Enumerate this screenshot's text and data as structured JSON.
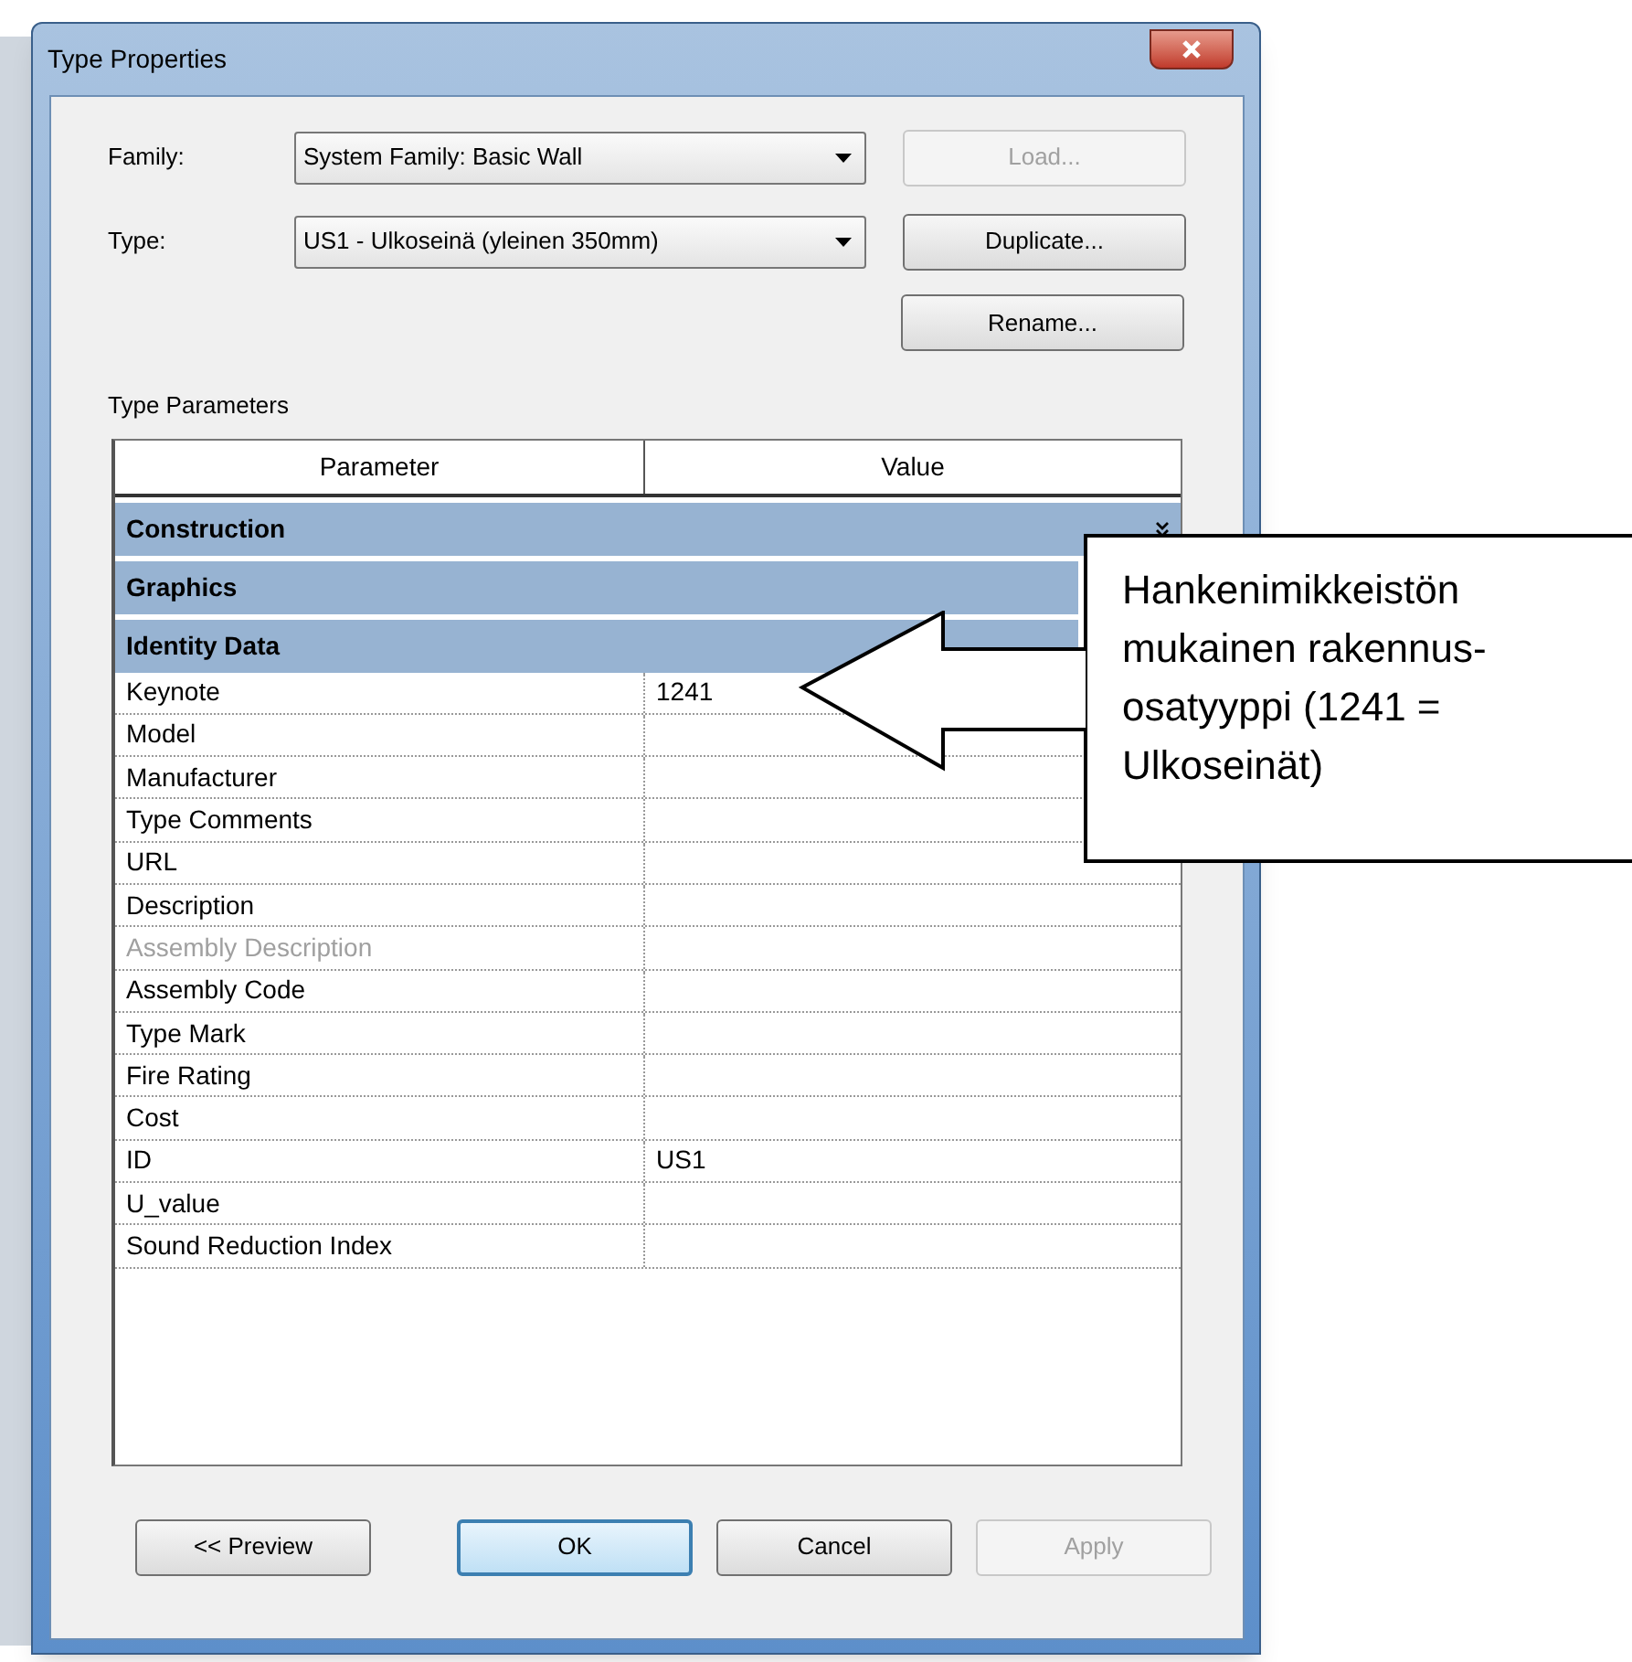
{
  "window": {
    "title": "Type Properties"
  },
  "fields": [
    {
      "label": "Family:",
      "value": "System Family: Basic Wall",
      "button": {
        "label": "Load...",
        "disabled": true
      }
    },
    {
      "label": "Type:",
      "value": "US1 - Ulkoseinä (yleinen 350mm)",
      "button": {
        "label": "Duplicate...",
        "disabled": false
      }
    }
  ],
  "rename_button": {
    "label": "Rename...",
    "disabled": false
  },
  "section_title": "Type Parameters",
  "table": {
    "columns": [
      "Parameter",
      "Value"
    ],
    "rows": [
      {
        "kind": "category",
        "label": "Construction",
        "expanded": false
      },
      {
        "kind": "category",
        "label": "Graphics"
      },
      {
        "kind": "category",
        "label": "Identity Data"
      },
      {
        "kind": "param",
        "label": "Keynote",
        "value": "1241",
        "disabled": false
      },
      {
        "kind": "param",
        "label": "Model",
        "disabled": false
      },
      {
        "kind": "param",
        "label": "Manufacturer",
        "disabled": false
      },
      {
        "kind": "param",
        "label": "Type Comments",
        "disabled": false
      },
      {
        "kind": "param",
        "label": "URL",
        "disabled": false
      },
      {
        "kind": "param",
        "label": "Description",
        "disabled": false
      },
      {
        "kind": "param",
        "label": "Assembly Description",
        "disabled": true
      },
      {
        "kind": "param",
        "label": "Assembly Code",
        "disabled": false
      },
      {
        "kind": "param",
        "label": "Type Mark",
        "disabled": false
      },
      {
        "kind": "param",
        "label": "Fire Rating",
        "disabled": false
      },
      {
        "kind": "param",
        "label": "Cost",
        "disabled": false
      },
      {
        "kind": "param",
        "label": "ID",
        "value": "US1",
        "disabled": false
      },
      {
        "kind": "param",
        "label": "U_value",
        "disabled": false
      },
      {
        "kind": "param",
        "label": "Sound Reduction Index",
        "disabled": false
      }
    ]
  },
  "buttons": [
    {
      "label": "<< Preview",
      "default": false,
      "disabled": false
    },
    {
      "label": "OK",
      "default": true,
      "disabled": false
    },
    {
      "label": "Cancel",
      "default": false,
      "disabled": false
    },
    {
      "label": "Apply",
      "default": false,
      "disabled": true
    }
  ],
  "callout": {
    "text": "Hankenimikkeistön mukainen rakennus-osatyyppi (1241 = Ulkoseinät)"
  }
}
